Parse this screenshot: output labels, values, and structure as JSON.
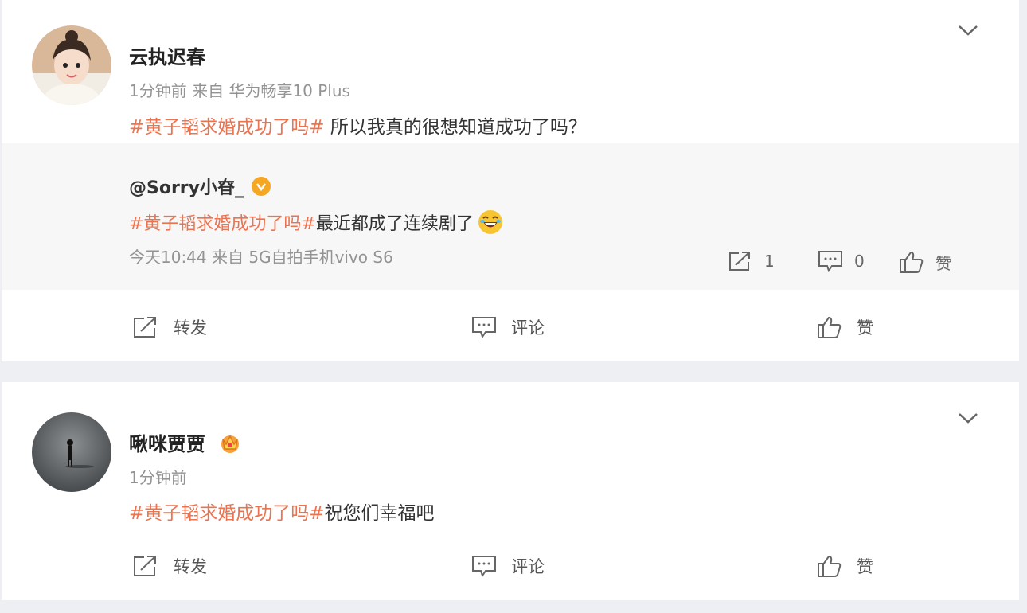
{
  "posts": [
    {
      "username": "云执迟春",
      "meta": "1分钟前  来自 华为畅享10 Plus",
      "hashtag": "#黄子韬求婚成功了吗#",
      "text": " 所以我真的很想知道成功了吗？",
      "repost": {
        "author": "@Sorry小昚_",
        "hashtag": "#黄子韬求婚成功了吗#",
        "text": "最近都成了连续剧了",
        "meta": "今天10:44 来自 5G自拍手机vivo S6",
        "share_count": "1",
        "comment_count": "0",
        "like_label": "赞"
      },
      "actions": {
        "share": "转发",
        "comment": "评论",
        "like": "赞"
      }
    },
    {
      "username": "啾咪贾贾",
      "meta": "1分钟前",
      "hashtag": "#黄子韬求婚成功了吗#",
      "text": "祝您们幸福吧",
      "actions": {
        "share": "转发",
        "comment": "评论",
        "like": "赞"
      }
    }
  ],
  "colors": {
    "hashtag": "#eb7350",
    "meta": "#939393",
    "background": "#eeeff2"
  }
}
